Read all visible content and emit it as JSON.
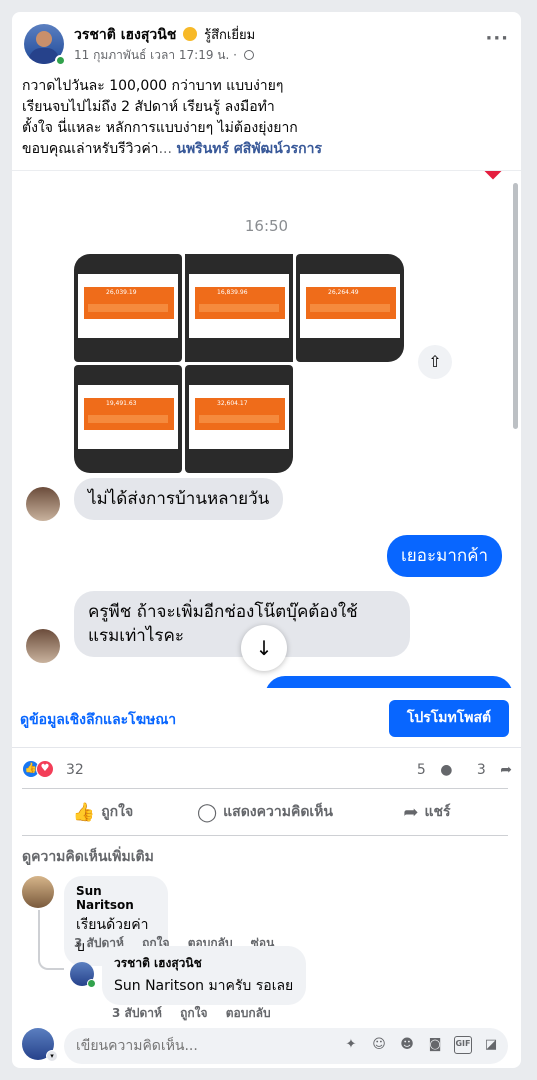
{
  "post": {
    "author": "วรชาติ เฮงสุวนิช",
    "feeling": "รู้สึกเยี่ยม",
    "timestamp": "11 กุมภาพันธ์ เวลา 17:19 น. ·",
    "caption_line1": "กวาดไปวันละ 100,000 กว่าบาท แบบง่ายๆ",
    "caption_line2": "เรียนจบไปไม่ถึง 2 สัปดาห์ เรียนรู้ ลงมือทำ",
    "caption_line3": "ตั้งใจ นี่แหละ หลักการแบบง่ายๆ ไม่ต้องยุ่งยาก",
    "caption_line4": "ขอบคุณเล่าหรับรีวิวค่า",
    "see_more": "...",
    "mention": "นพรินทร์ ศสิพัฒน์วรการ",
    "more_icon": "more-horizontal-icon"
  },
  "chat": {
    "time": "16:50",
    "thumbnails": [
      "26,039.19",
      "16,839.96",
      "26,264.49",
      "19,491.63",
      "32,604.17"
    ],
    "msg1": "ไม่ได้ส่งการบ้านหลายวัน",
    "msg2": "เยอะมากค้า",
    "msg3_line1": "ครูพีช ถ้าจะเพิ่มอีกช่องโน๊ตบุ๊คต้องใช้",
    "msg3_line2": "แรมเท่าไรคะ",
    "share_icon": "share-upload-icon",
    "scroll_down_icon": "arrow-down-icon"
  },
  "insights": {
    "link": "ดูข้อมูลเชิงลึกและโฆษณา",
    "promote": "โปรโมทโพสต์"
  },
  "stats": {
    "reactions_count": "32",
    "comments_count": "5",
    "shares_count": "3"
  },
  "actions": {
    "like": "ถูกใจ",
    "comment": "แสดงความคิดเห็น",
    "share": "แชร์"
  },
  "comments": {
    "see_more": "ดูความคิดเห็นเพิ่มเติม",
    "c1_name": "Sun Naritson",
    "c1_text": "เรียนด้วยค่าบ",
    "c1_time": "3 สัปดาห์",
    "c1_like": "ถูกใจ",
    "c1_reply": "ตอบกลับ",
    "c1_hide": "ซ่อน",
    "c2_name": "วรชาติ เฮงสุวนิช",
    "c2_text": "Sun Naritson มาครับ รอเลย",
    "c2_time": "3 สัปดาห์",
    "c2_like": "ถูกใจ",
    "c2_reply": "ตอบกลับ"
  },
  "composer": {
    "placeholder": "เขียนความคิดเห็น...",
    "icons": [
      "sticker-icon",
      "avatar-sticker-icon",
      "emoji-icon",
      "camera-icon",
      "gif-icon",
      "sticker-smile-icon"
    ]
  },
  "colors": {
    "accent": "#0866ff",
    "like": "#1877f2",
    "love": "#f33e58",
    "online": "#31a24c"
  }
}
